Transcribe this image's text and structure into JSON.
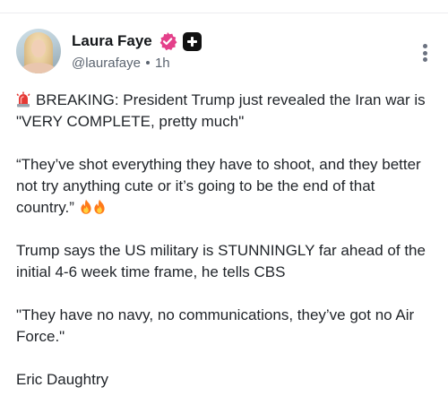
{
  "post": {
    "author": {
      "display_name": "Laura Faye",
      "handle": "@laurafaye",
      "time": "1h"
    },
    "icons": {
      "verified": "verified-badge-icon",
      "subscribe": "plus-icon",
      "more": "more-vertical-icon",
      "siren": "siren-emoji",
      "fire": "fire-emoji"
    },
    "colors": {
      "verified_badge": "#e4408a",
      "plus_badge": "#111111",
      "siren": "#e53935",
      "fire": "#ff7a1a"
    },
    "body": {
      "p1": "BREAKING: President Trump just revealed the Iran war is \"VERY COMPLETE, pretty much\"",
      "p2": "“They’ve shot everything they have to shoot, and they better not try anything cute or it’s going to be the end of that country.”",
      "p3": "Trump says the US military is STUNNINGLY far ahead of the initial 4-6 week time frame, he tells CBS",
      "p4": "\"They have no navy, no communications, they’ve got no Air Force.\"",
      "p5": "Eric Daughtry"
    }
  }
}
